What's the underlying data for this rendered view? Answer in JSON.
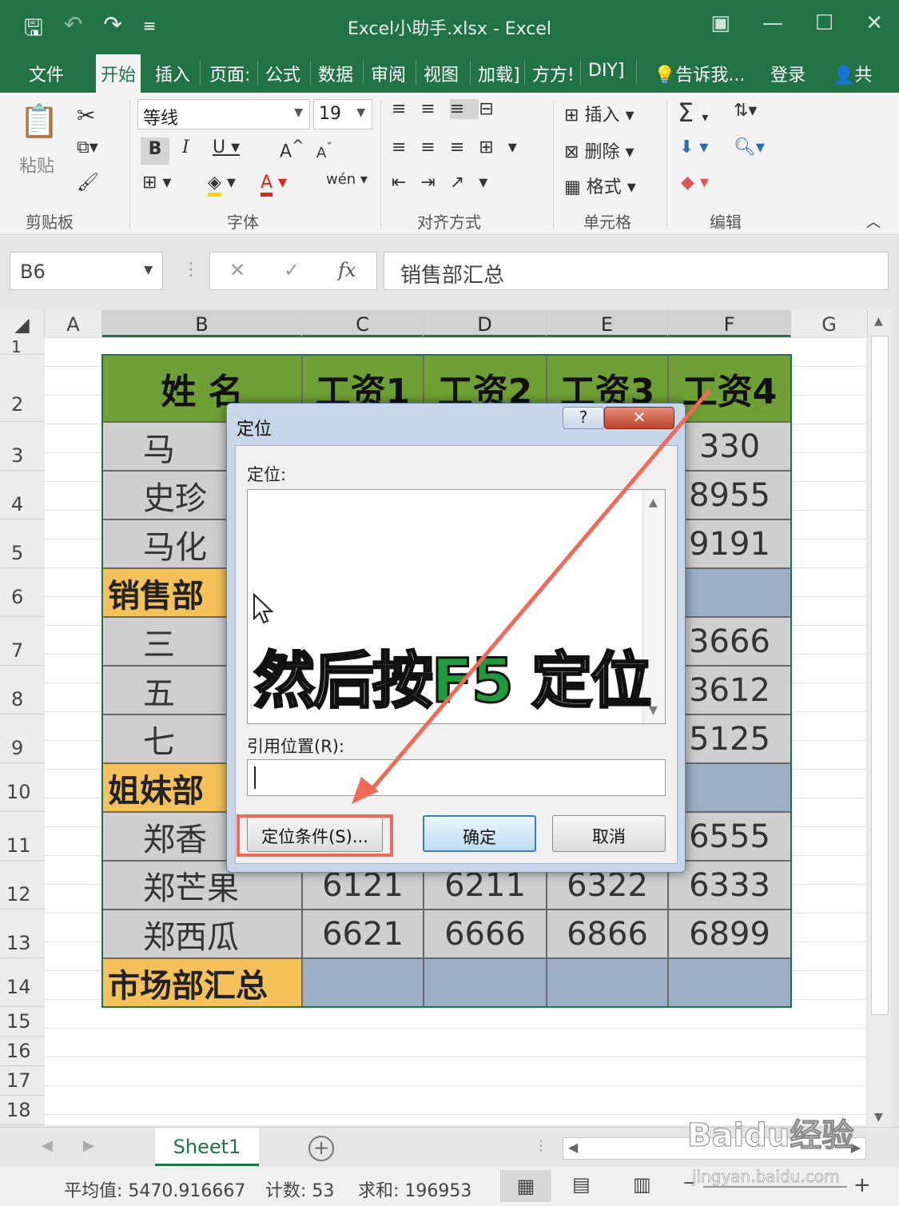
{
  "window": {
    "title": "Excel小助手.xlsx - Excel"
  },
  "ribbon_tabs": [
    "文件",
    "开始",
    "插入",
    "页面:",
    "公式",
    "数据",
    "审阅",
    "视图",
    "加载]",
    "方方!",
    "DIY]",
    "告诉我...",
    "登录",
    "共"
  ],
  "ribbon": {
    "paste": "粘贴",
    "font_name": "等线",
    "font_size": "19",
    "insert": "插入",
    "delete": "删除",
    "format": "格式",
    "groups": [
      "剪贴板",
      "字体",
      "对齐方式",
      "单元格",
      "编辑"
    ]
  },
  "formula_bar": {
    "name_box": "B6",
    "fx": "fx",
    "content": "销售部汇总"
  },
  "columns": [
    "A",
    "B",
    "C",
    "D",
    "E",
    "F",
    "G"
  ],
  "rows": [
    "1",
    "2",
    "3",
    "4",
    "5",
    "6",
    "7",
    "8",
    "9",
    "10",
    "11",
    "12",
    "13",
    "14",
    "15",
    "16",
    "17",
    "18"
  ],
  "table": {
    "headers": [
      "姓  名",
      "工资1",
      "工资2",
      "工资3",
      "工资4"
    ],
    "rows": [
      {
        "name": "马",
        "f": "330"
      },
      {
        "name": "史珍",
        "f": "8955"
      },
      {
        "name": "马化",
        "f": "9191"
      },
      {
        "name": "销售部",
        "dept": true
      },
      {
        "name": "三",
        "f": "3666"
      },
      {
        "name": "五",
        "f": "3612"
      },
      {
        "name": "七",
        "f": "5125"
      },
      {
        "name": "姐妹部",
        "dept": true
      },
      {
        "name": "郑香",
        "f": "6555"
      },
      {
        "name": "郑芒果",
        "c": "6121",
        "d": "6211",
        "e": "6322",
        "f": "6333"
      },
      {
        "name": "郑西瓜",
        "c": "6621",
        "d": "6666",
        "e": "6866",
        "f": "6899"
      },
      {
        "name": "市场部汇总",
        "dept": true
      }
    ]
  },
  "dialog": {
    "title": "定位",
    "help": "?",
    "close": "✕",
    "goto_label": "定位:",
    "reference_label": "引用位置(R):",
    "special_button": "定位条件(S)...",
    "ok_button": "确定",
    "cancel_button": "取消"
  },
  "overlay": {
    "text_prefix": "然后按",
    "text_key": "F5",
    "text_suffix": " 定位"
  },
  "sheet_tab": "Sheet1",
  "status": {
    "average": "平均值: 5470.916667",
    "count": "计数: 53",
    "sum": "求和: 196953"
  },
  "watermark": {
    "main": "Baidu经验",
    "sub": "jingyan.baidu.com"
  },
  "colors": {
    "excel_green": "#217346",
    "header_green": "#70a035",
    "dept_yellow": "#f5c15a",
    "arrow_red": "#f06a5a"
  }
}
